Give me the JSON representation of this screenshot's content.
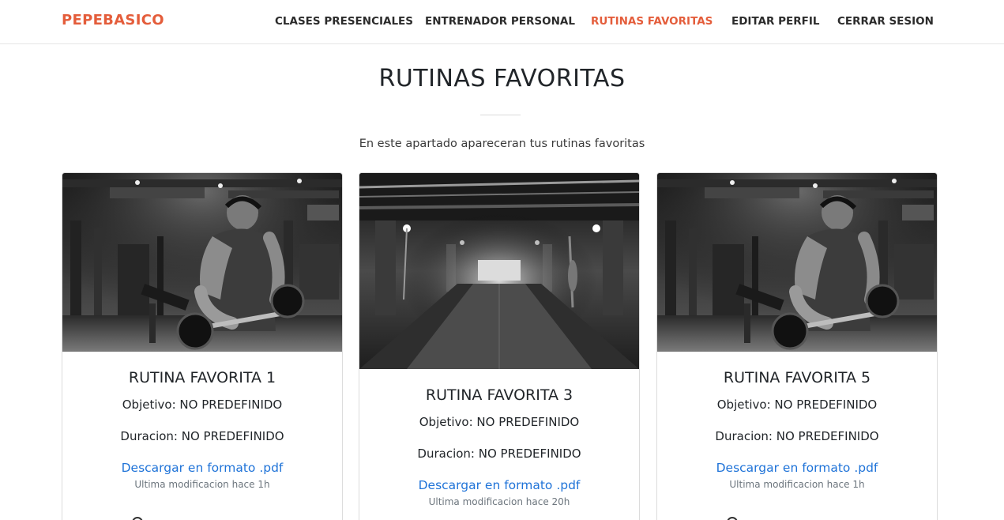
{
  "nav": {
    "brand": "PEPEBASICO",
    "links": [
      {
        "label": "CLASES PRESENCIALES",
        "active": false
      },
      {
        "label": "ENTRENADOR PERSONAL",
        "active": false
      },
      {
        "label": "RUTINAS FAVORITAS",
        "active": true
      },
      {
        "label": "EDITAR PERFIL",
        "active": false
      },
      {
        "label": "CERRAR SESION",
        "active": false
      }
    ]
  },
  "header": {
    "title": "RUTINAS FAVORITAS",
    "subtitle": "En este apartado apareceran tus rutinas favoritas"
  },
  "cards": [
    {
      "image": "gym-athlete-barbell-curl-photo",
      "title": "RUTINA FAVORITA 1",
      "objetivo": "Objetivo: NO PREDEFINIDO",
      "duracion": "Duracion: NO PREDEFINIDO",
      "download_label": "Descargar en formato .pdf",
      "meta": "Ultima modificacion hace 1h"
    },
    {
      "image": "empty-gym-hall-photo",
      "title": "RUTINA FAVORITA 3",
      "objetivo": "Objetivo: NO PREDEFINIDO",
      "duracion": "Duracion: NO PREDEFINIDO",
      "download_label": "Descargar en formato .pdf",
      "meta": "Ultima modificacion hace 20h"
    },
    {
      "image": "gym-athlete-barbell-curl-photo",
      "title": "RUTINA FAVORITA 5",
      "objetivo": "Objetivo: NO PREDEFINIDO",
      "duracion": "Duracion: NO PREDEFINIDO",
      "download_label": "Descargar en formato .pdf",
      "meta": "Ultima modificacion hace 1h"
    }
  ],
  "colors": {
    "accent": "#e45d3b",
    "link": "#1f73d8",
    "text": "#212529",
    "muted": "#6c757d",
    "border": "#dcdcdc"
  }
}
